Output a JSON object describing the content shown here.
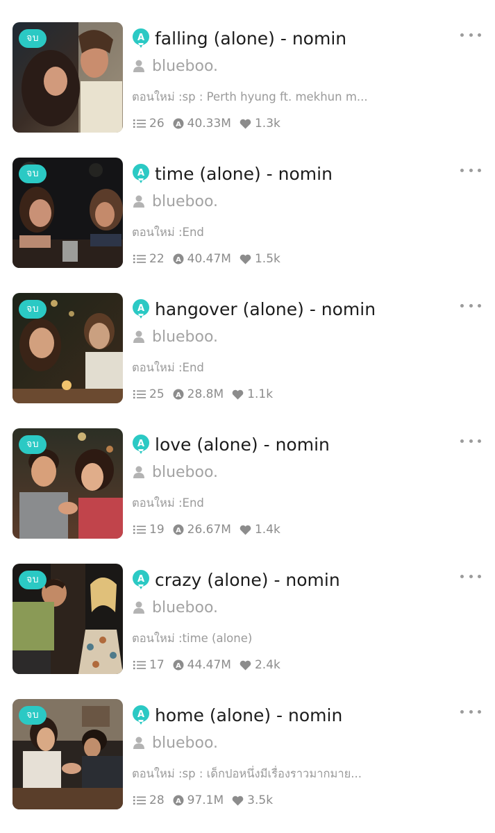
{
  "colors": {
    "accent": "#2bc9c4",
    "title": "#1c1c1c",
    "muted": "#a3a3a3",
    "stats": "#8c8c8c"
  },
  "icons": {
    "brand": "app-logo-icon",
    "author": "user-icon",
    "chapters": "list-icon",
    "views": "views-icon",
    "likes": "heart-icon",
    "more": "more-dots-icon"
  },
  "stories": [
    {
      "badge": "จบ",
      "title": "falling (alone) - nomin",
      "author": "blueboo.",
      "latest": "ตอนใหม่ :sp : Perth hyung ft. mekhun m...",
      "chapters": "26",
      "views": "40.33M",
      "likes": "1.3k"
    },
    {
      "badge": "จบ",
      "title": "time (alone) - nomin",
      "author": "blueboo.",
      "latest": "ตอนใหม่ :End",
      "chapters": "22",
      "views": "40.47M",
      "likes": "1.5k"
    },
    {
      "badge": "จบ",
      "title": "hangover (alone) - nomin",
      "author": "blueboo.",
      "latest": "ตอนใหม่ :End",
      "chapters": "25",
      "views": "28.8M",
      "likes": "1.1k"
    },
    {
      "badge": "จบ",
      "title": "love (alone) - nomin",
      "author": "blueboo.",
      "latest": "ตอนใหม่ :End",
      "chapters": "19",
      "views": "26.67M",
      "likes": "1.4k"
    },
    {
      "badge": "จบ",
      "title": "crazy (alone) - nomin",
      "author": "blueboo.",
      "latest": "ตอนใหม่ :time (alone)",
      "chapters": "17",
      "views": "44.47M",
      "likes": "2.4k"
    },
    {
      "badge": "จบ",
      "title": "home (alone) - nomin",
      "author": "blueboo.",
      "latest": "ตอนใหม่ :sp : เด็กปอหนึ่งมีเรื่องราวมากมาย...",
      "chapters": "28",
      "views": "97.1M",
      "likes": "3.5k"
    }
  ]
}
